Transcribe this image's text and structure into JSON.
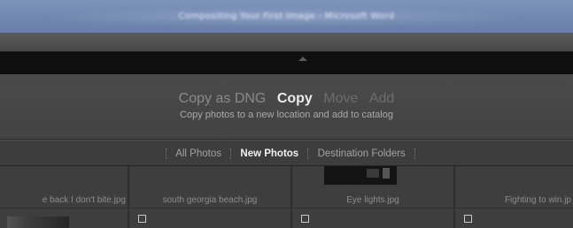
{
  "window": {
    "title": "Compositing Your First Image - Microsoft Word"
  },
  "import_modes": {
    "options": [
      {
        "label": "Copy as DNG"
      },
      {
        "label": "Copy"
      },
      {
        "label": "Move"
      },
      {
        "label": "Add"
      }
    ],
    "selected": "Copy",
    "description": "Copy photos to a new location and add to catalog"
  },
  "filters": {
    "items": [
      {
        "label": "All Photos"
      },
      {
        "label": "New Photos"
      },
      {
        "label": "Destination Folders"
      }
    ],
    "selected": "New Photos"
  },
  "grid": {
    "cells": [
      {
        "filename": "e back I don't bite.jpg"
      },
      {
        "filename": "south georgia beach.jpg"
      },
      {
        "filename": "Eye lights.jpg"
      },
      {
        "filename": "Fighting to win.jp"
      }
    ]
  }
}
